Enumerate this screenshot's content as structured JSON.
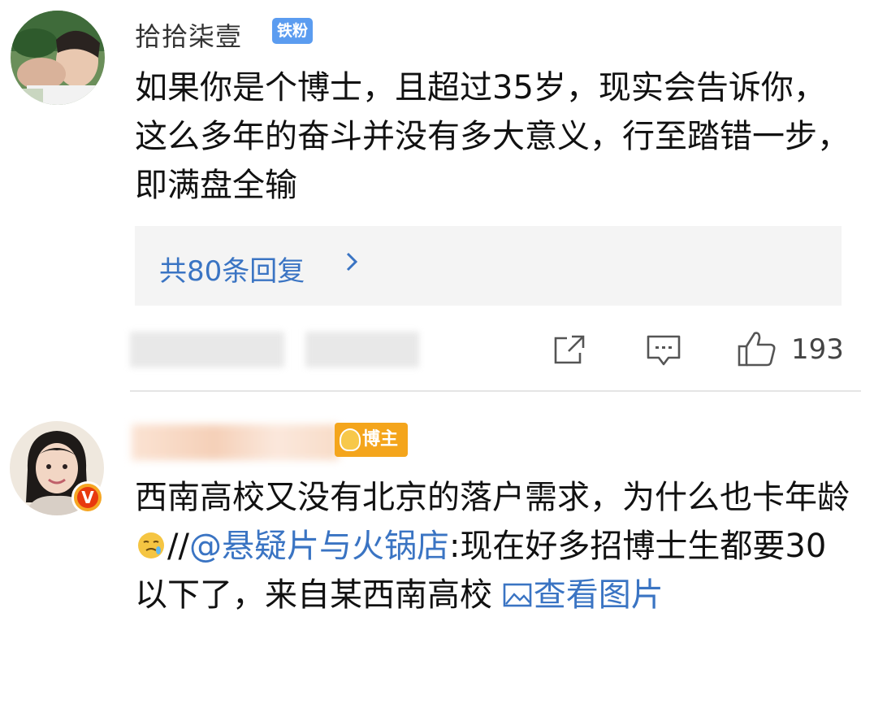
{
  "comment1": {
    "username": "拾拾柒壹",
    "badge": "铁粉",
    "text": "如果你是个博士，且超过35岁，现实会告诉你，这么多年的奋斗并没有多大意义，行至踏错一步，即满盘全输",
    "replies_label": "共80条回复",
    "likes": "193"
  },
  "comment2": {
    "badge": "博主",
    "text_before": "西南高校又没有北京的落户需求，为什么也卡年龄",
    "slashes": "//",
    "mention": "@悬疑片与火锅店",
    "text_after": ":现在好多招博士生都要30以下了，来自某西南高校 ",
    "view_picture": "查看图片"
  },
  "colors": {
    "link_blue": "#3a74c3",
    "fan_badge": "#5b9cf0",
    "blogger_badge": "#f4a51c",
    "verified_badge": "#e8390e"
  },
  "icons": [
    "share-icon",
    "comment-icon",
    "like-icon",
    "chevron-right-icon",
    "image-icon",
    "emoji-icon",
    "verified-v-icon"
  ]
}
